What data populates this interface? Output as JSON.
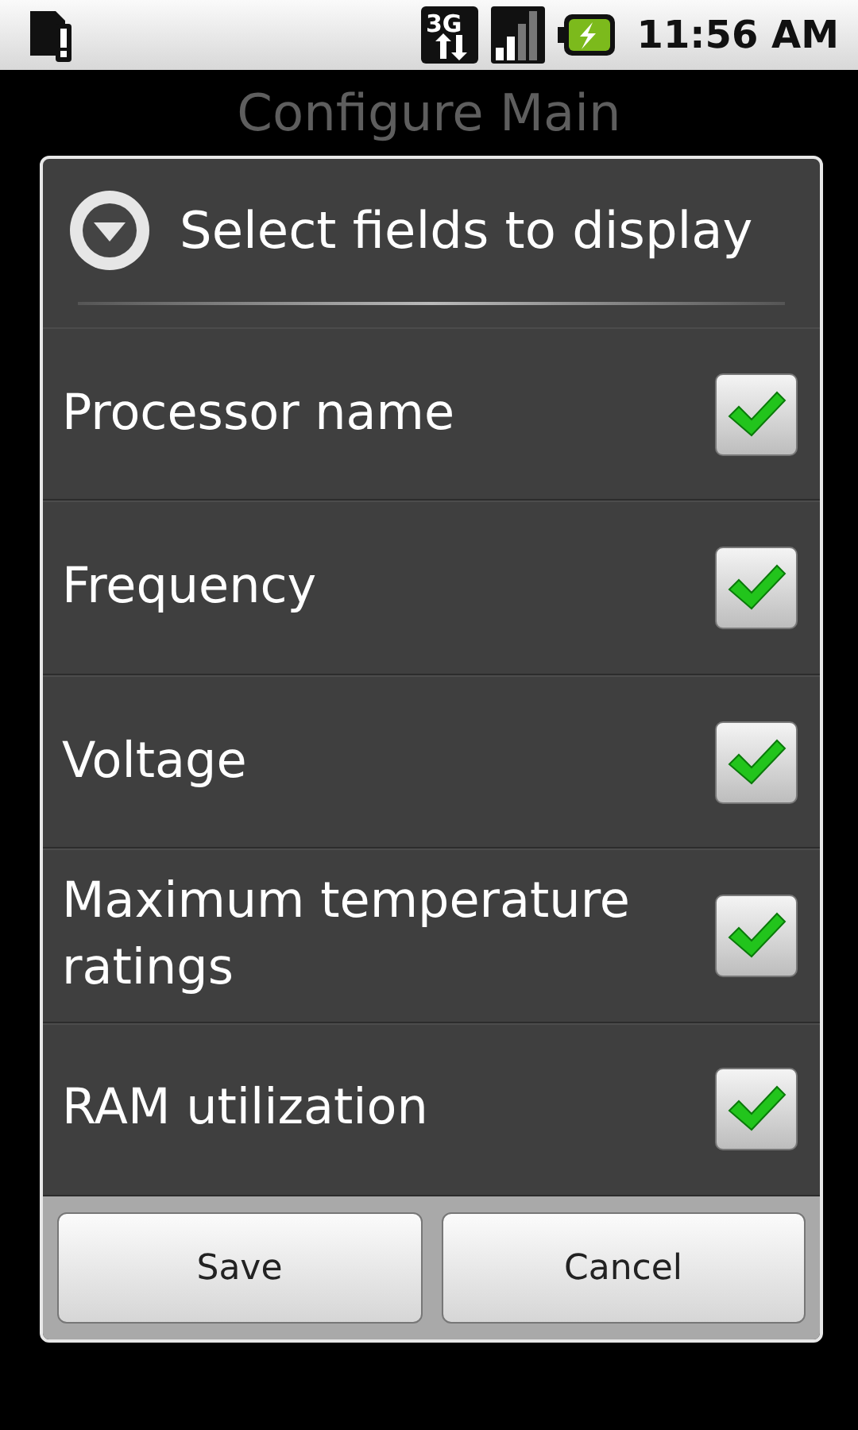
{
  "status_bar": {
    "network": "3G",
    "time": "11:56 AM"
  },
  "screen": {
    "title": "Configure Main"
  },
  "dialog": {
    "title": "Select fields to display",
    "items": [
      {
        "label": "Processor name",
        "checked": true
      },
      {
        "label": "Frequency",
        "checked": true
      },
      {
        "label": "Voltage",
        "checked": true
      },
      {
        "label": "Maximum temperature ratings",
        "checked": true
      },
      {
        "label": "RAM utilization",
        "checked": true
      }
    ],
    "buttons": [
      "Save",
      "Cancel"
    ]
  }
}
